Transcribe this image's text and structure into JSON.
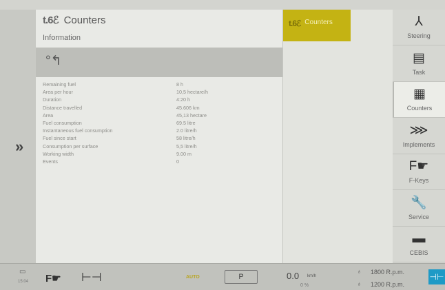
{
  "main": {
    "title": "Counters",
    "header_icon": "counters-tractor-icon",
    "info_label": "Information",
    "back_icon": "back-arrow-icon",
    "rows": [
      {
        "label": "Remaining fuel",
        "value": "8 h"
      },
      {
        "label": "Area per hour",
        "value": "10,5 hectare/h"
      },
      {
        "label": "Duration",
        "value": "4:20 h"
      },
      {
        "label": "Distance travelled",
        "value": "45.606 km"
      },
      {
        "label": "Area",
        "value": "45,13 hectare"
      },
      {
        "label": "Fuel consumption",
        "value": "69.5 litre"
      },
      {
        "label": "Instantaneous fuel consumption",
        "value": "2.0 litre/h"
      },
      {
        "label": "Fuel since start",
        "value": "58 litre/h"
      },
      {
        "label": "Consumption per surface",
        "value": "5,5 litre/h"
      },
      {
        "label": "Working width",
        "value": "9.00 m"
      },
      {
        "label": "Events",
        "value": "0"
      }
    ]
  },
  "left": {
    "expand_icon": "double-chevron-right-icon",
    "expand_glyph": "»"
  },
  "middle": {
    "tab_label": "Counters"
  },
  "sidebar": {
    "items": [
      {
        "label": "Steering",
        "icon": "steering-icon",
        "glyph": "⅄"
      },
      {
        "label": "Task",
        "icon": "clipboard-icon",
        "glyph": "▤"
      },
      {
        "label": "Counters",
        "icon": "counter-icon",
        "glyph": "▦",
        "active": true
      },
      {
        "label": "Implements",
        "icon": "implement-icon",
        "glyph": "⋙"
      },
      {
        "label": "F-Keys",
        "icon": "hand-pointer-icon",
        "glyph": "F☛"
      },
      {
        "label": "Service",
        "icon": "wrench-icon",
        "glyph": "🔧"
      },
      {
        "label": "CEBIS",
        "icon": "monitor-icon",
        "glyph": "▬"
      }
    ]
  },
  "bottom": {
    "clock": "15:04",
    "auto": "AUTO",
    "gear": "P",
    "speed": "0.0",
    "speed_unit": "km/h",
    "slip": "0 %",
    "rpm1": "1800 R.p.m.",
    "rpm2": "1200 R.p.m."
  },
  "colors": {
    "accent": "#c4b313",
    "pto": "#1e9ac6"
  }
}
